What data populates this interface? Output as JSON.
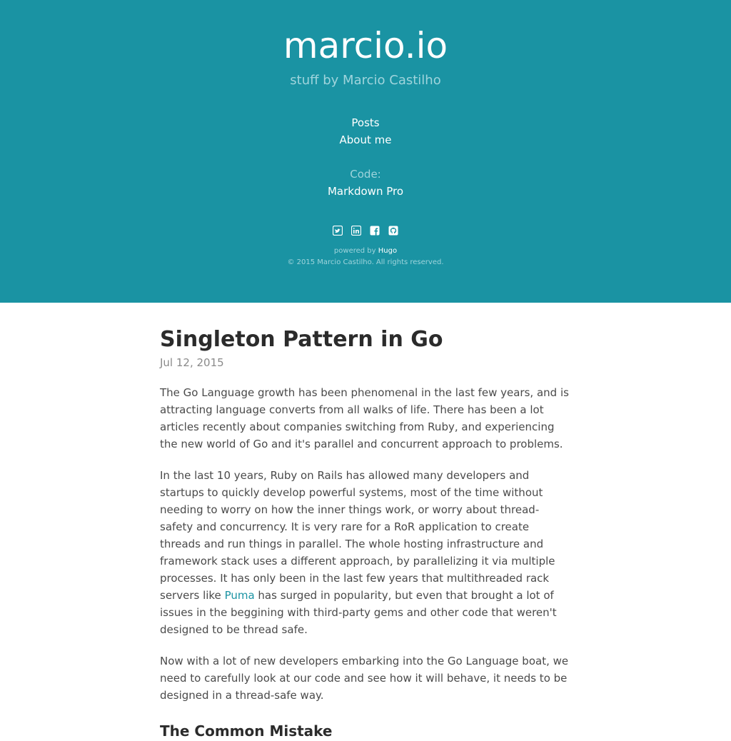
{
  "header": {
    "title": "marcio.io",
    "subtitle": "stuff by Marcio Castilho",
    "nav": {
      "posts": "Posts",
      "about": "About me",
      "code_label": "Code:",
      "markdown_pro": "Markdown Pro"
    },
    "social_icons": [
      "twitter-icon",
      "linkedin-icon",
      "facebook-icon",
      "github-icon"
    ],
    "powered_by_label": "powered by",
    "powered_by_link": "Hugo",
    "copyright": "© 2015 Marcio Castilho. All rights reserved."
  },
  "post": {
    "title": "Singleton Pattern in Go",
    "date": "Jul 12, 2015",
    "paragraph1": "The Go Language growth has been phenomenal in the last few years, and is attracting language converts from all walks of life. There has been a lot articles recently about companies switching from Ruby, and experiencing the new world of Go and it's parallel and concurrent approach to problems.",
    "paragraph2_before_link": "In the last 10 years, Ruby on Rails has allowed many developers and startups to quickly develop powerful systems, most of the time without needing to worry on how the inner things work, or worry about thread-safety and concurrency. It is very rare for a RoR application to create threads and run things in parallel. The whole hosting infrastructure and framework stack uses a different approach, by parallelizing it via multiple processes. It has only been in the last few years that multithreaded rack servers like ",
    "paragraph2_link": "Puma",
    "paragraph2_after_link": " has surged in popularity, but even that brought a lot of issues in the beggining with third-party gems and other code that weren't designed to be thread safe.",
    "paragraph3": "Now with a lot of new developers embarking into the Go Language boat, we need to carefully look at our code and see how it will behave, it needs to be designed in a thread-safe way.",
    "section_heading": "The Common Mistake"
  },
  "colors": {
    "header_bg": "#1a93a3",
    "muted_header_text": "#9fd4dc",
    "body_text": "#4a4a4a",
    "link": "#1a93a3"
  }
}
